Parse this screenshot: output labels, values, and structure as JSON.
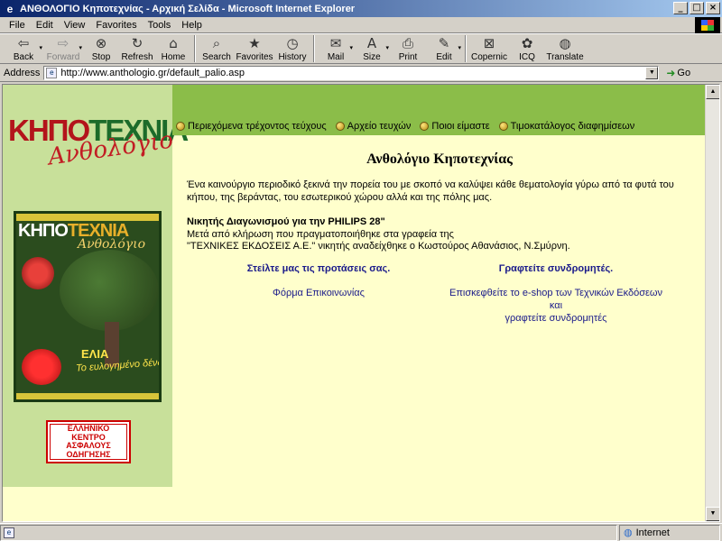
{
  "window": {
    "title": "ΑΝΘΟΛΟΓΙΟ Κηποτεχνίας - Αρχική Σελίδα - Microsoft Internet Explorer",
    "min": "_",
    "max": "□",
    "close": "×"
  },
  "menu": [
    "File",
    "Edit",
    "View",
    "Favorites",
    "Tools",
    "Help"
  ],
  "toolbar": {
    "back": "Back",
    "forward": "Forward",
    "stop": "Stop",
    "refresh": "Refresh",
    "home": "Home",
    "search": "Search",
    "favorites": "Favorites",
    "history": "History",
    "mail": "Mail",
    "size": "Size",
    "print": "Print",
    "edit": "Edit",
    "copernic": "Copernic",
    "icq": "ICQ",
    "translate": "Translate"
  },
  "address": {
    "label": "Address",
    "url": "http://www.anthologio.gr/default_palio.asp",
    "go": "Go"
  },
  "brand": {
    "part1": "ΚΗΠΟ",
    "part2": "ΤΕΧΝΙΑ",
    "script": "Ανθολόγιο"
  },
  "cover": {
    "title_a": "ΚΗΠΟ",
    "title_b": "ΤΕΧΝΙΑ",
    "script": "Ανθολόγιο",
    "headline": "ΕΛΙΑ",
    "subline": "Το ευλογημένο δένδρο"
  },
  "badge": [
    "ΕΛΛΗΝΙΚΟ",
    "ΚΕΝΤΡΟ",
    "ΑΣΦΑΛΟΥΣ",
    "ΟΔΗΓΗΣΗΣ"
  ],
  "nav": [
    "Περιεχόμενα τρέχοντος τεύχους",
    "Αρχείο τευχών",
    "Ποιοι είμαστε",
    "Τιμοκατάλογος διαφημίσεων"
  ],
  "page": {
    "title": "Ανθολόγιο Κηποτεχνίας",
    "intro": "Ένα καινούργιο περιοδικό ξεκινά την πορεία του με σκοπό να καλύψει κάθε θεματολογία γύρω από τα φυτά του κήπου, της βεράντας, του εσωτερικού χώρου αλλά και της πόλης μας.",
    "winner_heading": "Νικητής Διαγωνισμού για την PHILIPS 28\"",
    "winner_line1": "Μετά από κλήρωση που πραγματοποιήθηκε στα γραφεία της",
    "winner_line2": "\"ΤΕΧΝΙΚΕΣ ΕΚΔΟΣΕΙΣ Α.Ε.\" νικητής αναδείχθηκε ο Κωστούρος Αθανάσιος, Ν.Σμύρνη.",
    "left_heading": "Στείλτε μας τις προτάσεις σας.",
    "left_link": "Φόρμα Επικοινωνίας",
    "right_heading": "Γραφτείτε συνδρομητές.",
    "right_link_1": "Επισκεφθείτε το e-shop των Τεχνικών Εκδόσεων και",
    "right_link_2": "γραφτείτε συνδρομητές"
  },
  "status": {
    "text": "",
    "zone": "Internet"
  }
}
